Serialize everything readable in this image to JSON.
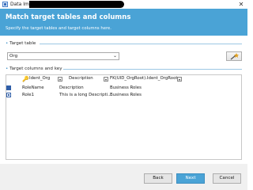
{
  "window": {
    "title": "Data Import"
  },
  "header": {
    "title": "Match target tables and columns",
    "subtitle": "Specify the target tables and target columns here."
  },
  "target_table": {
    "group_label": "Target table",
    "selected": "Org"
  },
  "target_columns": {
    "group_label": "Target columns and key",
    "header": [
      "Ident_Org",
      "Description",
      "FK(UID_OrgRoot).Ident_OrgRoot"
    ],
    "rows": [
      [
        "RoleName",
        "Description",
        "Business Roles"
      ],
      [
        "Role1",
        "This is a long Descripti...",
        "Business Roles"
      ]
    ]
  },
  "buttons": {
    "back": "Back",
    "next": "Next",
    "cancel": "Cancel"
  },
  "colors": {
    "accent": "#4aa3d6",
    "header_bg": "#4aa3d6"
  }
}
